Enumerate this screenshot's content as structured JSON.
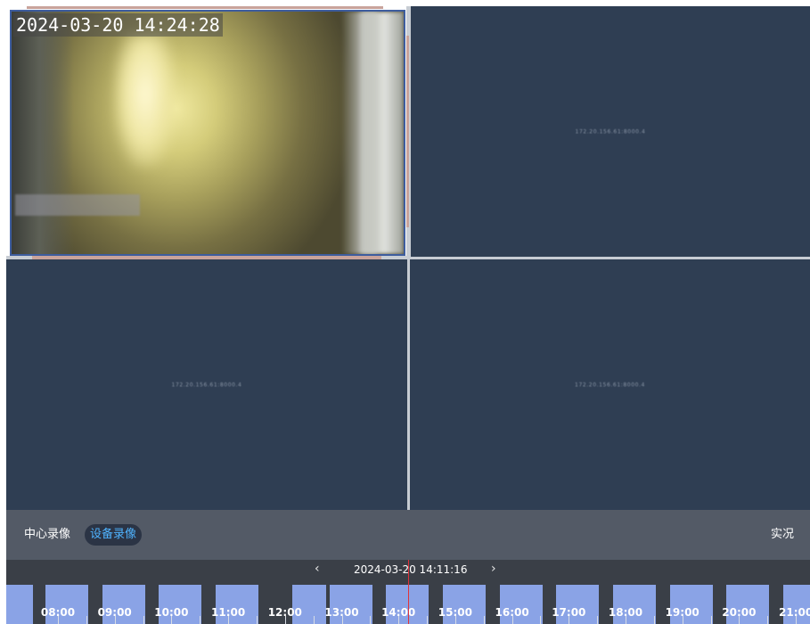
{
  "video_grid": {
    "active_camera": {
      "timestamp": "2024-03-20 14:24:28"
    },
    "cameras": [
      {
        "label": "172.20.156.61:8000.4"
      },
      {
        "label": "172.20.156.61:8000.4"
      },
      {
        "label": "172.20.156.61:8000.4"
      }
    ]
  },
  "control_bar": {
    "center_recording": "中心录像",
    "device_recording": "设备录像",
    "live": "实况"
  },
  "timeline": {
    "prev": "‹",
    "next": "›",
    "current_date": "2024-03-20 14:11:16",
    "hours": [
      "08:00",
      "09:00",
      "10:00",
      "11:00",
      "12:00",
      "13:00",
      "14:00",
      "15:00",
      "16:00",
      "17:00",
      "18:00",
      "19:00",
      "20:00",
      "21:00"
    ]
  },
  "colors": {
    "accent": "#4fb3ff",
    "record_block": "#8aa3e6",
    "playhead": "#e0333a",
    "empty_tile": "#2f3e53"
  }
}
